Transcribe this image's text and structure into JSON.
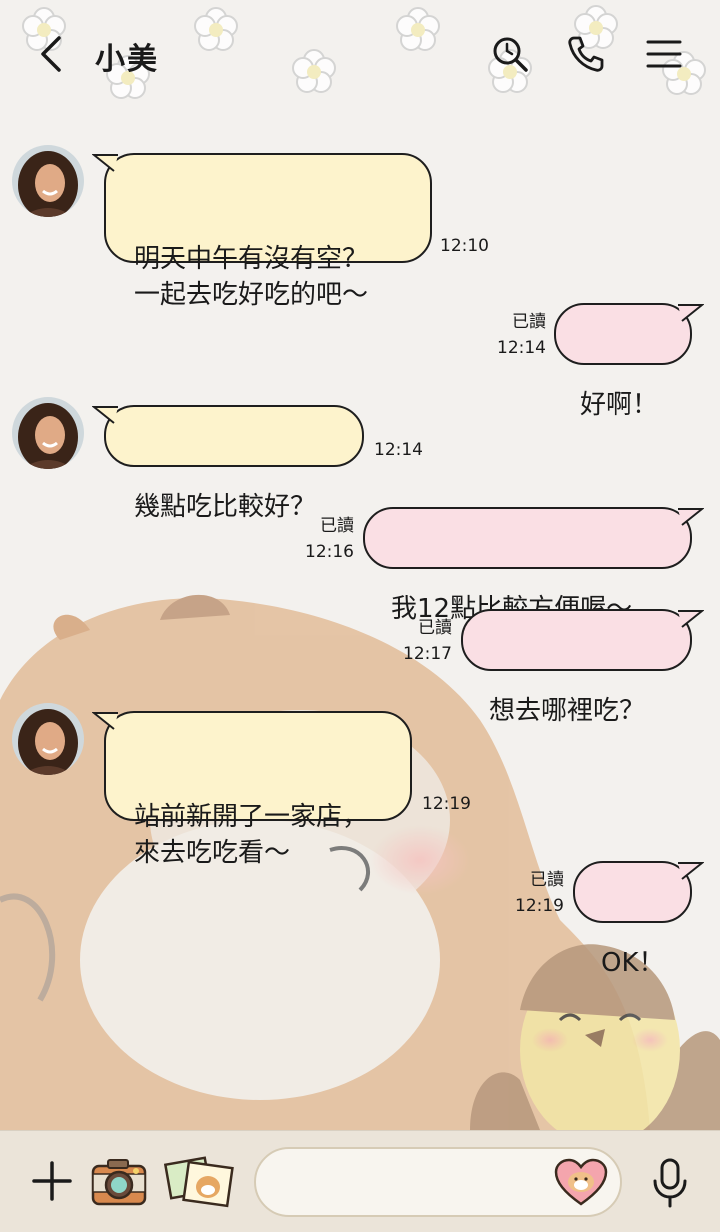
{
  "header": {
    "title": "小美"
  },
  "messages": [
    {
      "dir": "in",
      "text": "明天中午有沒有空？\n一起去吃好吃的吧～",
      "time": "12:10"
    },
    {
      "dir": "out",
      "text": "好啊！",
      "read": "已讀",
      "time": "12:14"
    },
    {
      "dir": "in",
      "text": "幾點吃比較好？",
      "time": "12:14"
    },
    {
      "dir": "out",
      "text": "我12點比較方便喔～",
      "read": "已讀",
      "time": "12:16"
    },
    {
      "dir": "out",
      "text": "想去哪裡吃？",
      "read": "已讀",
      "time": "12:17"
    },
    {
      "dir": "in",
      "text": "站前新開了一家店，\n來去吃吃看～",
      "time": "12:19"
    },
    {
      "dir": "out",
      "text": "OK！",
      "read": "已讀",
      "time": "12:19"
    }
  ],
  "input": {
    "value": "",
    "placeholder": ""
  },
  "icons": {
    "back": "chevron-left-icon",
    "search": "search-history-icon",
    "call": "phone-icon",
    "menu": "hamburger-menu-icon",
    "plus": "plus-icon",
    "camera": "camera-icon",
    "photo": "photo-album-icon",
    "sticker": "heart-sticker-icon",
    "mic": "microphone-icon"
  },
  "colors": {
    "background": "#f3f1ee",
    "incoming_bubble": "#fdf3cc",
    "outgoing_bubble": "#fadfe4",
    "bubble_border": "#1e1e1e",
    "input_bar": "#ebe4d9"
  }
}
